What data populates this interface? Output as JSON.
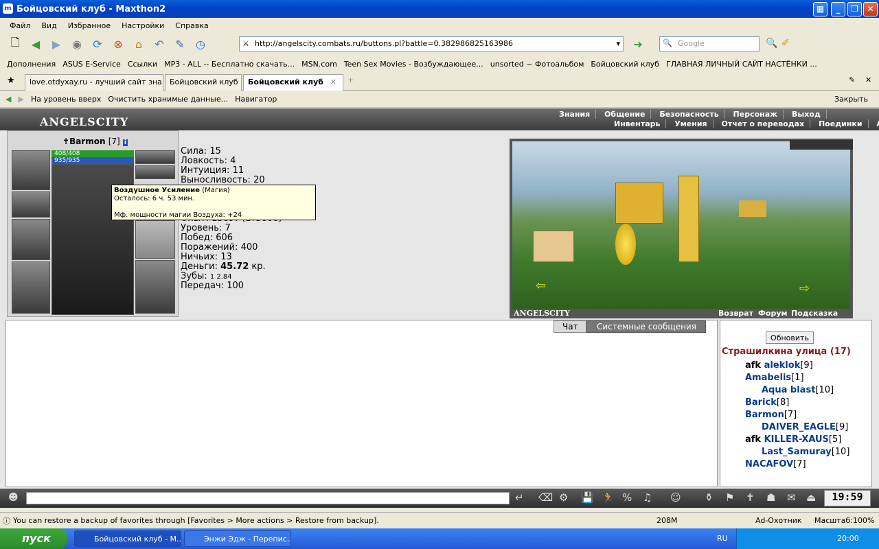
{
  "window": {
    "title": "Бойцовский клуб - Maxthon2"
  },
  "menu": [
    "Файл",
    "Вид",
    "Избранное",
    "Настройки",
    "Справка"
  ],
  "address": {
    "url": "http://angelscity.combats.ru/buttons.pl?battle=0.382986825163986"
  },
  "search": {
    "placeholder": "Google"
  },
  "bookmarks": [
    "Дополнения",
    "ASUS E-Service",
    "Ссылки",
    "MP3 - ALL -- Бесплатно скачать...",
    "MSN.com",
    "Teen Sex Movies - Возбуждающее...",
    "unsorted ~ Фотоальбом",
    "Бойцовский клуб",
    "ГЛАВНАЯ  ЛИЧНЫЙ САЙТ НАСТЁНКИ ..."
  ],
  "tabs": [
    "love.otdyxay.ru - лучший сайт зна...",
    "Бойцовский клуб",
    "Бойцовский клуб"
  ],
  "navbar": {
    "up": "На уровень вверх",
    "clear": "Очистить хранимые данные...",
    "navigator": "Навигатор",
    "close": "Закрыть"
  },
  "game": {
    "logo": "ANGELSCITY",
    "nav_row1": [
      "Знания",
      "Общение",
      "Безопасность",
      "Персонаж",
      "Выход"
    ],
    "nav_row2": [
      "Инвентарь",
      "Умения",
      "Отчет о переводах",
      "Поединки",
      "Анкета"
    ],
    "character": {
      "name": "Barmon",
      "level": "[7]",
      "hp": "408/408",
      "mana": "935/935"
    },
    "stats": [
      {
        "label": "Сила:",
        "value": "15"
      },
      {
        "label": "Ловкость:",
        "value": "4"
      },
      {
        "label": "Интуиция:",
        "value": "11"
      },
      {
        "label": "Выносливость:",
        "value": "20"
      },
      {
        "label": "Опыт:",
        "value": "1369? (1?5000)"
      },
      {
        "label": "Уровень:",
        "value": "7"
      },
      {
        "label": "Побед:",
        "value": "606"
      },
      {
        "label": "Поражений:",
        "value": "400"
      },
      {
        "label": "Ничьих:",
        "value": "13"
      },
      {
        "label": "Деньги:",
        "value": "45.72",
        "suffix": "кр."
      },
      {
        "label": "Зубы:",
        "value": "1  2.84"
      },
      {
        "label": "Передач:",
        "value": "100"
      }
    ],
    "tooltip": {
      "title": "Воздушное Усиление",
      "type": "(Магия)",
      "remaining": "Осталось: 6 ч. 53 мин.",
      "effect": "Мф. мощности магии Воздуха: +24"
    },
    "scene_links": [
      "Возврат",
      "Форум",
      "Подсказка"
    ],
    "chat_tabs": [
      "Чат",
      "Системные сообщения"
    ],
    "refresh": "Обновить",
    "room": "Страшилкина улица (17)",
    "users": [
      {
        "prefix": "afk",
        "name": "aleklok",
        "level": "[9]"
      },
      {
        "prefix": "",
        "name": "Amabelis",
        "level": "[1]"
      },
      {
        "prefix": "",
        "name": "Aqua blast",
        "level": "[10]"
      },
      {
        "prefix": "",
        "name": "Barick",
        "level": "[8]"
      },
      {
        "prefix": "",
        "name": "Barmon",
        "level": "[7]"
      },
      {
        "prefix": "",
        "name": "DAIVER_EAGLE",
        "level": "[9]"
      },
      {
        "prefix": "afk",
        "name": "KILLER-XAUS",
        "level": "[5]"
      },
      {
        "prefix": "",
        "name": "Last_Samuray",
        "level": "[10]"
      },
      {
        "prefix": "",
        "name": "NACAFOV",
        "level": "[7]"
      }
    ],
    "clock": "19:59"
  },
  "status": {
    "text": "You can restore a backup of favorites through [Favorites > More actions > Restore from backup].",
    "memory": "208M",
    "adblock": "Ad-Охотник",
    "zoom": "Масштаб:100%"
  },
  "taskbar": {
    "start": "пуск",
    "items": [
      "Бойцовский клуб - М...",
      "Энжи Эдж - Перепис..."
    ],
    "lang": "RU",
    "time": "20:00"
  }
}
